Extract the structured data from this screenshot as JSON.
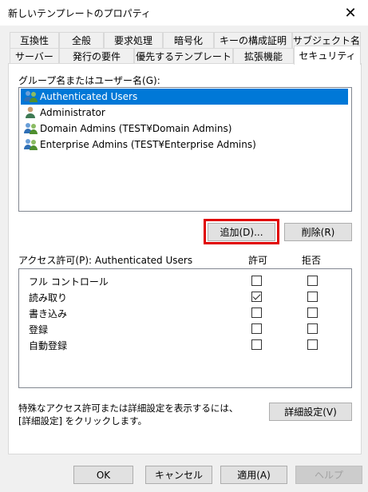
{
  "window": {
    "title": "新しいテンプレートのプロパティ",
    "close_glyph": "✕"
  },
  "tabs_row1": [
    {
      "label": "互換性"
    },
    {
      "label": "全般"
    },
    {
      "label": "要求処理"
    },
    {
      "label": "暗号化"
    },
    {
      "label": "キーの構成証明"
    },
    {
      "label": "サブジェクト名"
    }
  ],
  "tabs_row2": [
    {
      "label": "サーバー"
    },
    {
      "label": "発行の要件"
    },
    {
      "label": "優先するテンプレート"
    },
    {
      "label": "拡張機能"
    },
    {
      "label": "セキュリティ",
      "active": true
    }
  ],
  "security": {
    "group_label": "グループ名またはユーザー名(G):",
    "principals": [
      {
        "name": "Authenticated Users",
        "icon": "users-group-icon",
        "selected": true
      },
      {
        "name": "Administrator",
        "icon": "user-icon",
        "selected": false
      },
      {
        "name": "Domain Admins (TEST¥Domain Admins)",
        "icon": "users-group-icon",
        "selected": false
      },
      {
        "name": "Enterprise Admins (TEST¥Enterprise Admins)",
        "icon": "users-group-icon",
        "selected": false
      }
    ],
    "add_button": "追加(D)...",
    "remove_button": "削除(R)",
    "permissions_label": "アクセス許可(P): Authenticated Users",
    "allow_header": "許可",
    "deny_header": "拒否",
    "permissions": [
      {
        "name": "フル コントロール",
        "allow": false,
        "deny": false
      },
      {
        "name": "読み取り",
        "allow": true,
        "deny": false
      },
      {
        "name": "書き込み",
        "allow": false,
        "deny": false
      },
      {
        "name": "登録",
        "allow": false,
        "deny": false
      },
      {
        "name": "自動登録",
        "allow": false,
        "deny": false
      }
    ],
    "advanced_text": "特殊なアクセス許可または詳細設定を表示するには、[詳細設定] をクリックします。",
    "advanced_button": "詳細設定(V)"
  },
  "footer": {
    "ok": "OK",
    "cancel": "キャンセル",
    "apply": "適用(A)",
    "help": "ヘルプ"
  },
  "colors": {
    "selection": "#0078d7",
    "highlight_border": "#e00000"
  }
}
